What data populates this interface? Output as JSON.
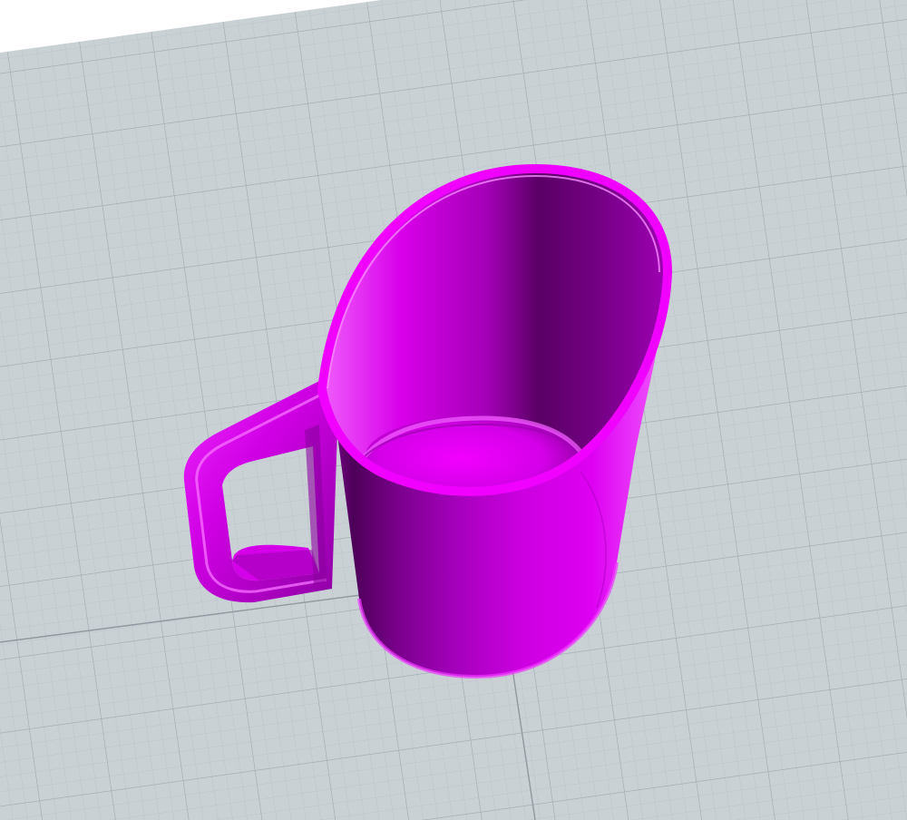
{
  "viewport": {
    "background_color": "#ffffff",
    "grid_color": "#c9d1d5",
    "grid_line_color": "#aeb8be",
    "grid_axis_color": "#8f999f"
  },
  "model": {
    "object": "mug",
    "color": "#e000f0",
    "shadow_color": "#5c0066",
    "highlight_color": "#f35cff"
  }
}
